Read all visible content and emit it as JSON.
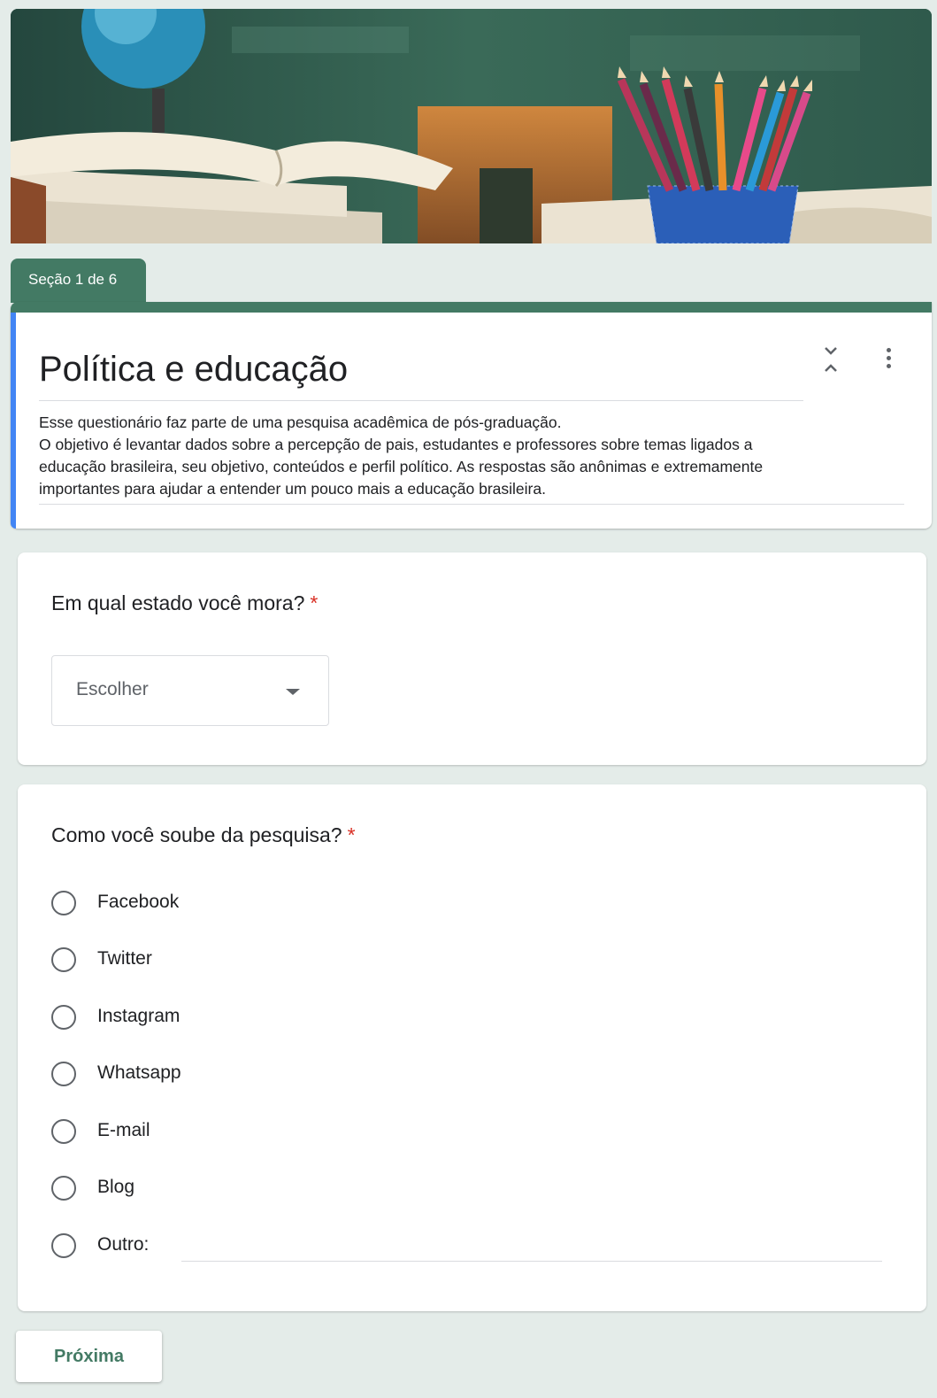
{
  "section": {
    "label": "Seção 1 de 6"
  },
  "form": {
    "title": "Política e educação",
    "description_lines": [
      "Esse questionário faz parte de uma pesquisa acadêmica de pós-graduação.",
      "O objetivo é levantar dados sobre a percepção de pais, estudantes e professores sobre temas ligados a",
      "educação brasileira, seu objetivo, conteúdos e perfil político. As respostas são anônimas e extremamente",
      "importantes para ajudar a entender um pouco mais a educação brasileira."
    ]
  },
  "questions": [
    {
      "title": "Em qual estado você mora?",
      "required_mark": "*",
      "type": "dropdown",
      "placeholder": "Escolher"
    },
    {
      "title": "Como você soube da pesquisa?",
      "required_mark": "*",
      "type": "radio",
      "options": [
        "Facebook",
        "Twitter",
        "Instagram",
        "Whatsapp",
        "E-mail",
        "Blog",
        "Outro:"
      ]
    }
  ],
  "navigation": {
    "next_label": "Próxima"
  },
  "colors": {
    "accent": "#437a64",
    "left_bar": "#4285f4",
    "required": "#d93025",
    "background": "#e4ece9"
  },
  "icons": [
    "collapse-icon",
    "more-vert-icon",
    "dropdown-caret-icon"
  ]
}
